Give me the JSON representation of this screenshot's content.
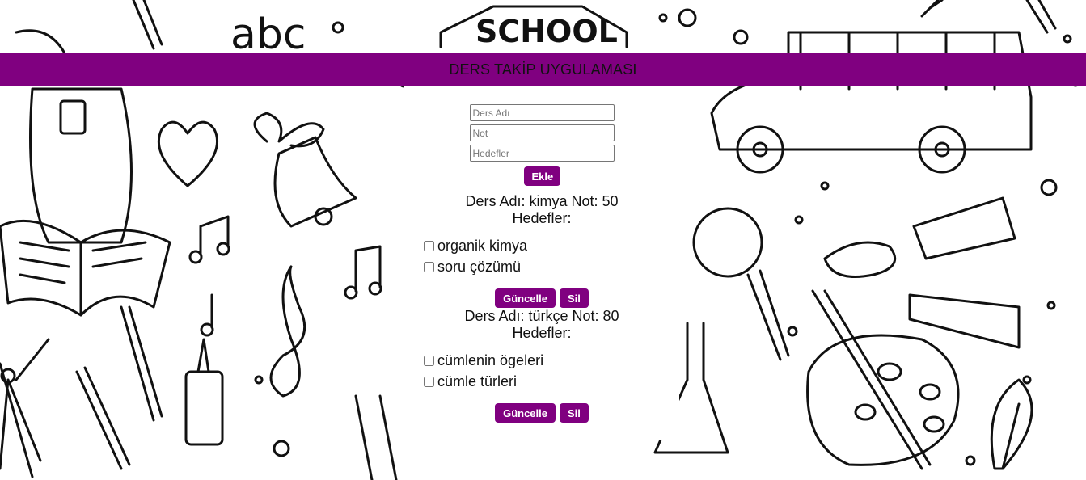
{
  "header": {
    "title": "DERS TAKİP UYGULAMASI"
  },
  "background": {
    "school_sign": "SCHOOL",
    "letters": "abc"
  },
  "form": {
    "course_name_placeholder": "Ders Adı",
    "grade_placeholder": "Not",
    "goals_placeholder": "Hedefler",
    "add_label": "Ekle"
  },
  "courses": [
    {
      "title": "Ders Adı: kimya Not: 50",
      "goals_label": "Hedefler:",
      "goals": [
        "organik kimya",
        "soru çözümü"
      ],
      "update_label": "Güncelle",
      "delete_label": "Sil"
    },
    {
      "title": "Ders Adı: türkçe Not: 80",
      "goals_label": "Hedefler:",
      "goals": [
        "cümlenin ögeleri",
        "cümle türleri"
      ],
      "update_label": "Güncelle",
      "delete_label": "Sil"
    }
  ],
  "colors": {
    "accent": "#800080",
    "panel": "#ffffff"
  }
}
